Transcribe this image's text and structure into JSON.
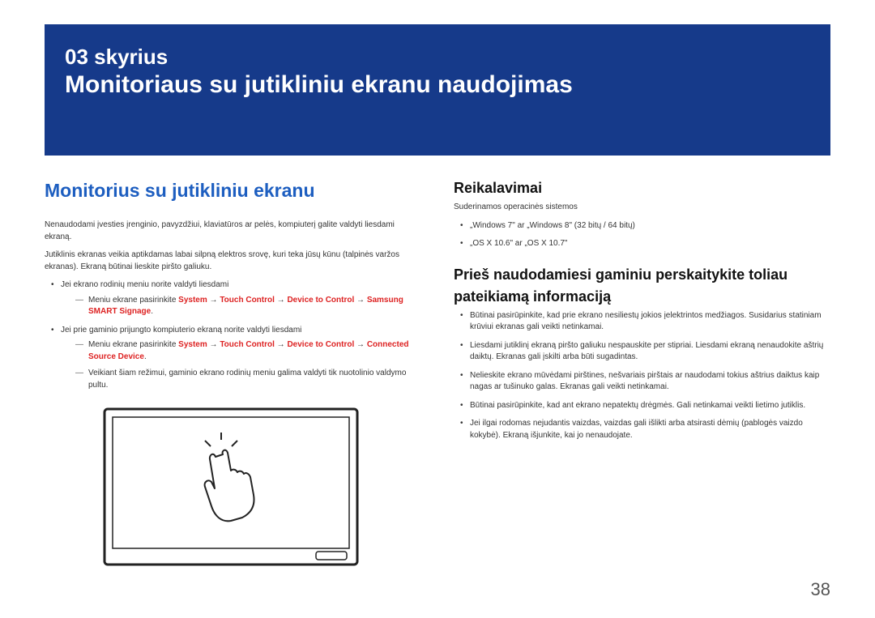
{
  "header": {
    "chapter_number": "03 skyrius",
    "chapter_title": "Monitoriaus su jutikliniu ekranu naudojimas"
  },
  "left": {
    "heading": "Monitorius su jutikliniu ekranu",
    "intro1": "Nenaudodami įvesties įrenginio, pavyzdžiui, klaviatūros ar pelės, kompiuterį galite valdyti liesdami ekraną.",
    "intro2": "Jutiklinis ekranas veikia aptikdamas labai silpną elektros srovę, kuri teka jūsų kūnu (talpinės varžos ekranas). Ekraną būtinai lieskite piršto galiuku.",
    "bullets": [
      "Jei ekrano rodinių meniu norite valdyti liesdami",
      "Jei prie gaminio prijungto kompiuterio ekraną norite valdyti liesdami"
    ],
    "sub1_prefix": "Meniu ekrane pasirinkite ",
    "sub1_path_system": "System",
    "sub1_arrow": " → ",
    "sub1_touch": "Touch Control",
    "sub1_device": "Device to Control",
    "sub1_target1": "Samsung SMART Signage",
    "sub1_target2": "Connected Source Device",
    "sub1_suffix": ".",
    "sub3": "Veikiant šiam režimui, gaminio ekrano rodinių meniu galima valdyti tik nuotolinio valdymo pultu."
  },
  "right": {
    "req_heading": "Reikalavimai",
    "compat": "Suderinamos operacinės sistemos",
    "os": [
      "„Windows 7\" ar „Windows 8\" (32 bitų / 64 bitų)",
      "„OS X 10.6\" ar „OS X 10.7\""
    ],
    "warn_heading1": "Prieš naudodamiesi gaminiu perskaitykite toliau",
    "warn_heading2": "pateikiamą informaciją",
    "warnings": [
      "Būtinai pasirūpinkite, kad prie ekrano nesiliestų jokios įelektrintos medžiagos. Susidarius statiniam krūviui ekranas gali veikti netinkamai.",
      "Liesdami jutiklinį ekraną piršto galiuku nespauskite per stipriai. Liesdami ekraną nenaudokite aštrių daiktų. Ekranas gali įskilti arba būti sugadintas.",
      "Nelieskite ekrano mūvėdami pirštines, nešvariais pirštais ar naudodami tokius aštrius daiktus kaip nagas ar tušinuko galas. Ekranas gali veikti netinkamai.",
      "Būtinai pasirūpinkite, kad ant ekrano nepatektų drėgmės. Gali netinkamai veikti lietimo jutiklis.",
      "Jei ilgai rodomas nejudantis vaizdas, vaizdas gali išlikti arba atsirasti dėmių (pablogės vaizdo kokybė). Ekraną išjunkite, kai jo nenaudojate."
    ]
  },
  "page_number": "38"
}
